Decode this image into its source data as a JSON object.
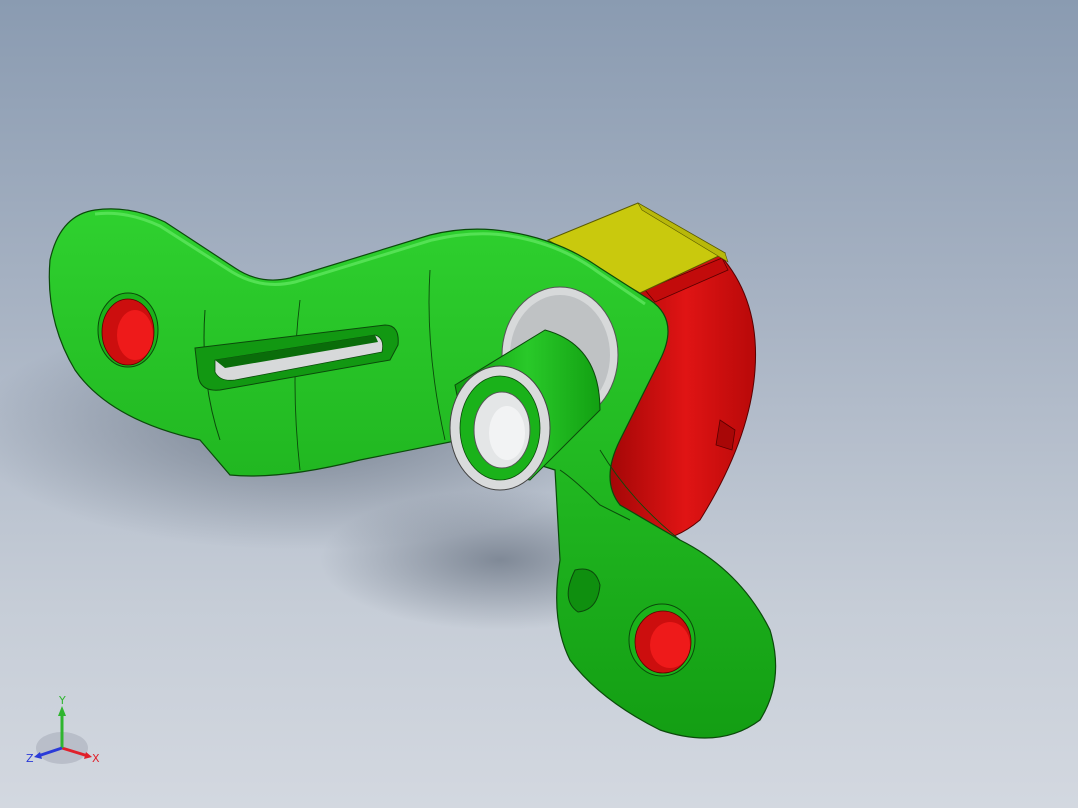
{
  "viewport": {
    "background_top": "#8a9bb1",
    "background_bottom": "#d3d8e0"
  },
  "model": {
    "bracket_color": "#1fb81f",
    "housing_color": "#d10f0f",
    "cap_color": "#c8c80c",
    "bushing_color": "#d7d9da"
  },
  "triad": {
    "x_label": "X",
    "y_label": "Y",
    "z_label": "Z",
    "x_color": "#e0202a",
    "y_color": "#2fb52f",
    "z_color": "#2a3ad8"
  }
}
